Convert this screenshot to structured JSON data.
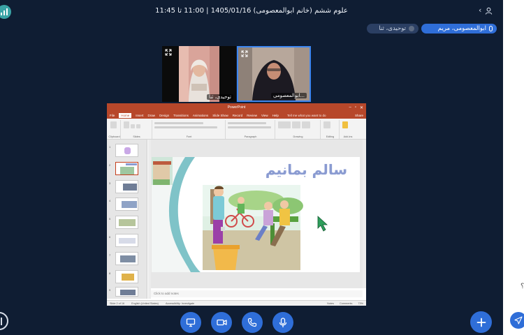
{
  "header": {
    "meeting_title": "علوم ششم (خانم ابوالمعصومی) 1405/01/16 | 11:00 تا 11:45",
    "icons": [
      "app-logo-icon",
      "chevron-icon",
      "user-icon"
    ]
  },
  "participants": [
    {
      "name": "ابوالمعصومی، مریم",
      "active": true,
      "icon": "microphone-icon"
    },
    {
      "name": "توحیدی، ثنا",
      "active": false,
      "icon": "status-dot-icon"
    }
  ],
  "videos": [
    {
      "label": "توحیدی، ثنا",
      "icon": "expand-icon"
    },
    {
      "label": "ابوالمعصومی...",
      "icon": "expand-icon",
      "speaking": true
    }
  ],
  "powerpoint": {
    "window_title": "PowerPoint",
    "tabs": [
      "File",
      "Home",
      "Insert",
      "Draw",
      "Design",
      "Transitions",
      "Animations",
      "Slide Show",
      "Record",
      "Review",
      "View",
      "Help"
    ],
    "active_tab": "Home",
    "tell_me": "Tell me what you want to do",
    "share_label": "Share",
    "ribbon_groups": [
      "Clipboard",
      "Slides",
      "Font",
      "Paragraph",
      "Drawing",
      "Editing",
      "Add-ins"
    ],
    "slide_title": "سالم بمانیم",
    "notes_placeholder": "Click to add notes",
    "status": {
      "slide_counter": "Slide 2 of 16",
      "language": "English (United States)",
      "accessibility": "Accessibility: Investigate",
      "notes": "Notes",
      "comments": "Comments",
      "zoom": "73%"
    },
    "thumb_numbers": [
      "1",
      "2",
      "3",
      "4",
      "5",
      "6",
      "7",
      "8",
      "9"
    ]
  },
  "controls": [
    {
      "name": "screen-share-button",
      "icon": "monitor-icon"
    },
    {
      "name": "camera-button",
      "icon": "camera-icon"
    },
    {
      "name": "hangup-button",
      "icon": "phone-icon"
    },
    {
      "name": "microphone-button",
      "icon": "microphone-icon"
    }
  ],
  "colors": {
    "background": "#0f1d33",
    "accent": "#2f6ed8",
    "ppt_red": "#b7472a",
    "slide_title": "#8a9bd1"
  }
}
